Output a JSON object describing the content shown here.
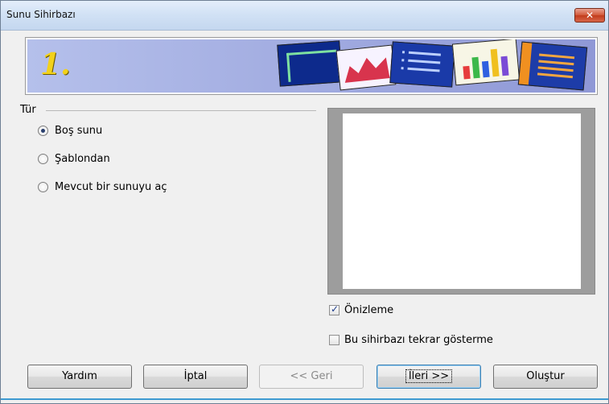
{
  "window": {
    "title": "Sunu Sihirbazı"
  },
  "banner": {
    "step_number": "1."
  },
  "type_group": {
    "label": "Tür",
    "options": [
      {
        "label": "Boş sunu",
        "checked": true
      },
      {
        "label": "Şablondan",
        "checked": false
      },
      {
        "label": "Mevcut bir sunuyu aç",
        "checked": false
      }
    ]
  },
  "checkboxes": {
    "preview": {
      "label": "Önizleme",
      "checked": true
    },
    "dont_show": {
      "label": "Bu sihirbazı tekrar gösterme",
      "checked": false
    }
  },
  "buttons": {
    "help": "Yardım",
    "cancel": "İptal",
    "back": "<< Geri",
    "next": "İleri >>",
    "create": "Oluştur"
  },
  "colors": {
    "title_gradient_top": "#e4eefb",
    "banner_bg": "#9fa9df",
    "step_number": "#f2d11a",
    "preview_border": "#9d9d9d"
  }
}
